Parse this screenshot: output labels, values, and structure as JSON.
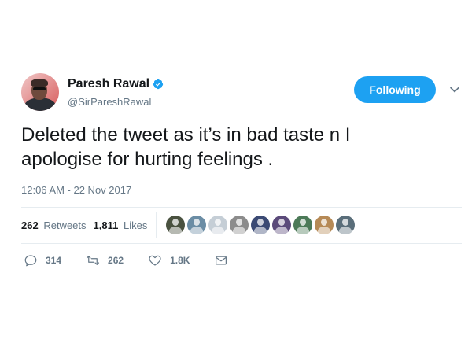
{
  "user": {
    "display_name": "Paresh Rawal",
    "handle": "@SirPareshRawal",
    "verified": true
  },
  "follow_button": {
    "label": "Following"
  },
  "tweet": {
    "text": "Deleted the tweet as it’s in bad taste n I\napologise for hurting feelings .",
    "timestamp": "12:06 AM - 22 Nov 2017"
  },
  "stats": {
    "retweets_count": "262",
    "retweets_label": "Retweets",
    "likes_count": "1,811",
    "likes_label": "Likes"
  },
  "likers": [
    {
      "color": "#4a5240"
    },
    {
      "color": "#6b8da5"
    },
    {
      "color": "#c5ced6"
    },
    {
      "color": "#8c8c8c"
    },
    {
      "color": "#3b4a74"
    },
    {
      "color": "#5b4a7a"
    },
    {
      "color": "#4c7a58"
    },
    {
      "color": "#b68a56"
    },
    {
      "color": "#5a6e7a"
    }
  ],
  "actions": {
    "reply_count": "314",
    "retweet_count": "262",
    "like_count": "1.8K"
  },
  "colors": {
    "accent": "#1da1f2",
    "text_primary": "#14171a",
    "text_secondary": "#657786",
    "divider": "#e6ecf0"
  }
}
